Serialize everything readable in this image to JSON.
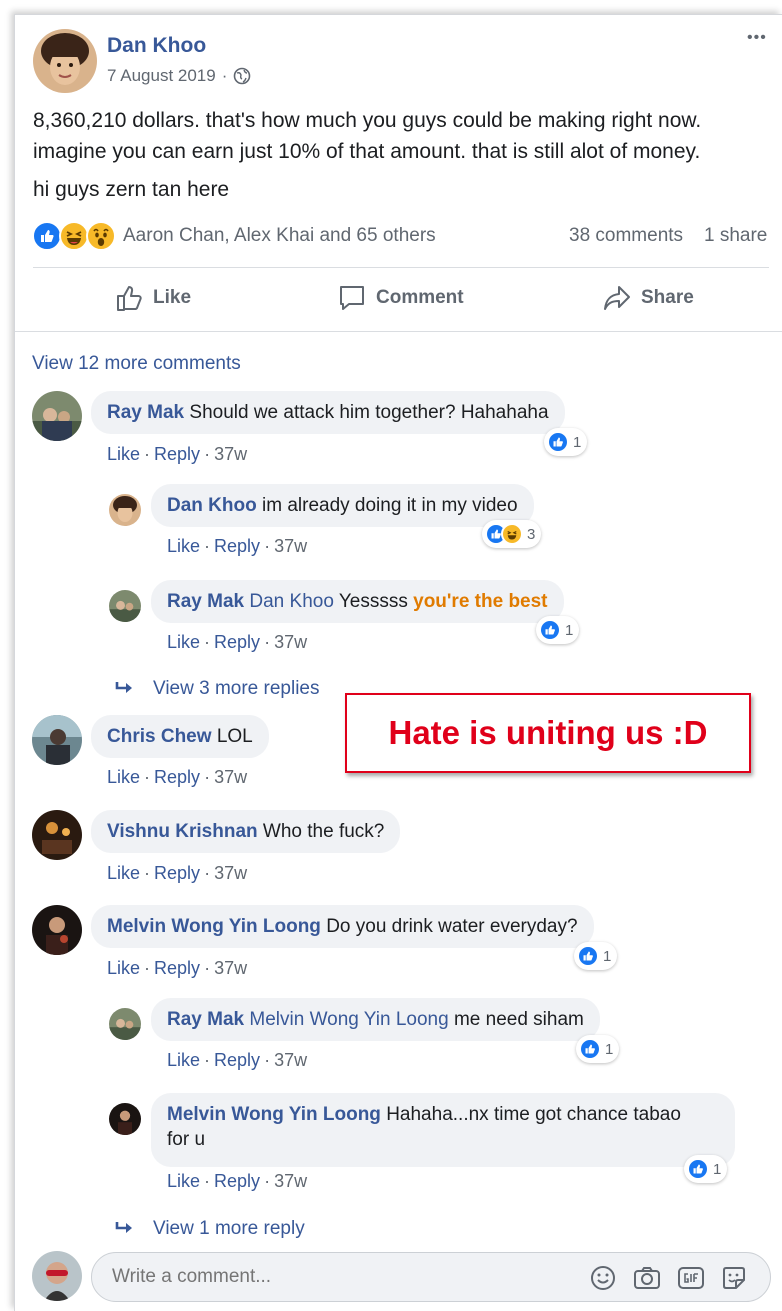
{
  "post": {
    "author": "Dan Khoo",
    "date": "7 August 2019",
    "date_separator": "·",
    "more_menu": "•••",
    "text_line1": "8,360,210 dollars. that's how much you guys could be making right now.",
    "text_line2": "imagine you can earn just 10% of that amount. that is still alot of money.",
    "text_line3": "hi guys zern tan here",
    "reactions_summary": "Aaron Chan, Alex Khai and 65 others",
    "comments_count": "38 comments",
    "shares_count": "1 share"
  },
  "action_bar": {
    "like": "Like",
    "comment": "Comment",
    "share": "Share"
  },
  "comments_section": {
    "view_more_comments": "View 12 more comments",
    "dot": "·",
    "comments": [
      {
        "author": "Ray Mak",
        "text": "Should we attack him together? Hahahaha",
        "like": "Like",
        "reply": "Reply",
        "time": "37w",
        "reaction_count": "1"
      },
      {
        "author": "Dan Khoo",
        "text": "im already doing it in my video",
        "like": "Like",
        "reply": "Reply",
        "time": "37w",
        "reaction_count": "3"
      },
      {
        "author": "Ray Mak",
        "mention": "Dan Khoo",
        "text": "Yesssss",
        "highlight": "you're the best",
        "like": "Like",
        "reply": "Reply",
        "time": "37w",
        "reaction_count": "1"
      },
      {
        "author": "Chris Chew",
        "text": "LOL",
        "like": "Like",
        "reply": "Reply",
        "time": "37w"
      },
      {
        "author": "Vishnu Krishnan",
        "text": "Who the fuck?",
        "like": "Like",
        "reply": "Reply",
        "time": "37w"
      },
      {
        "author": "Melvin Wong Yin Loong",
        "text": "Do you drink water everyday?",
        "like": "Like",
        "reply": "Reply",
        "time": "37w",
        "reaction_count": "1"
      },
      {
        "author": "Ray Mak",
        "mention": "Melvin Wong Yin Loong",
        "text": "me need siham",
        "like": "Like",
        "reply": "Reply",
        "time": "37w",
        "reaction_count": "1"
      },
      {
        "author": "Melvin Wong Yin Loong",
        "text_line1": "Hahaha...nx time got chance tabao",
        "text_line2": "for u",
        "like": "Like",
        "reply": "Reply",
        "time": "37w",
        "reaction_count": "1"
      }
    ],
    "view_more_replies_1": "View 3 more replies",
    "view_more_replies_2": "View 1 more reply"
  },
  "composer": {
    "placeholder": "Write a comment..."
  },
  "annotation": "Hate is uniting us :D",
  "colors": {
    "link": "#385898",
    "like_blue": "#1877f2",
    "highlight_orange": "#e07b00",
    "annotation_red": "#e0001a",
    "bubble_bg": "#f0f2f5"
  }
}
